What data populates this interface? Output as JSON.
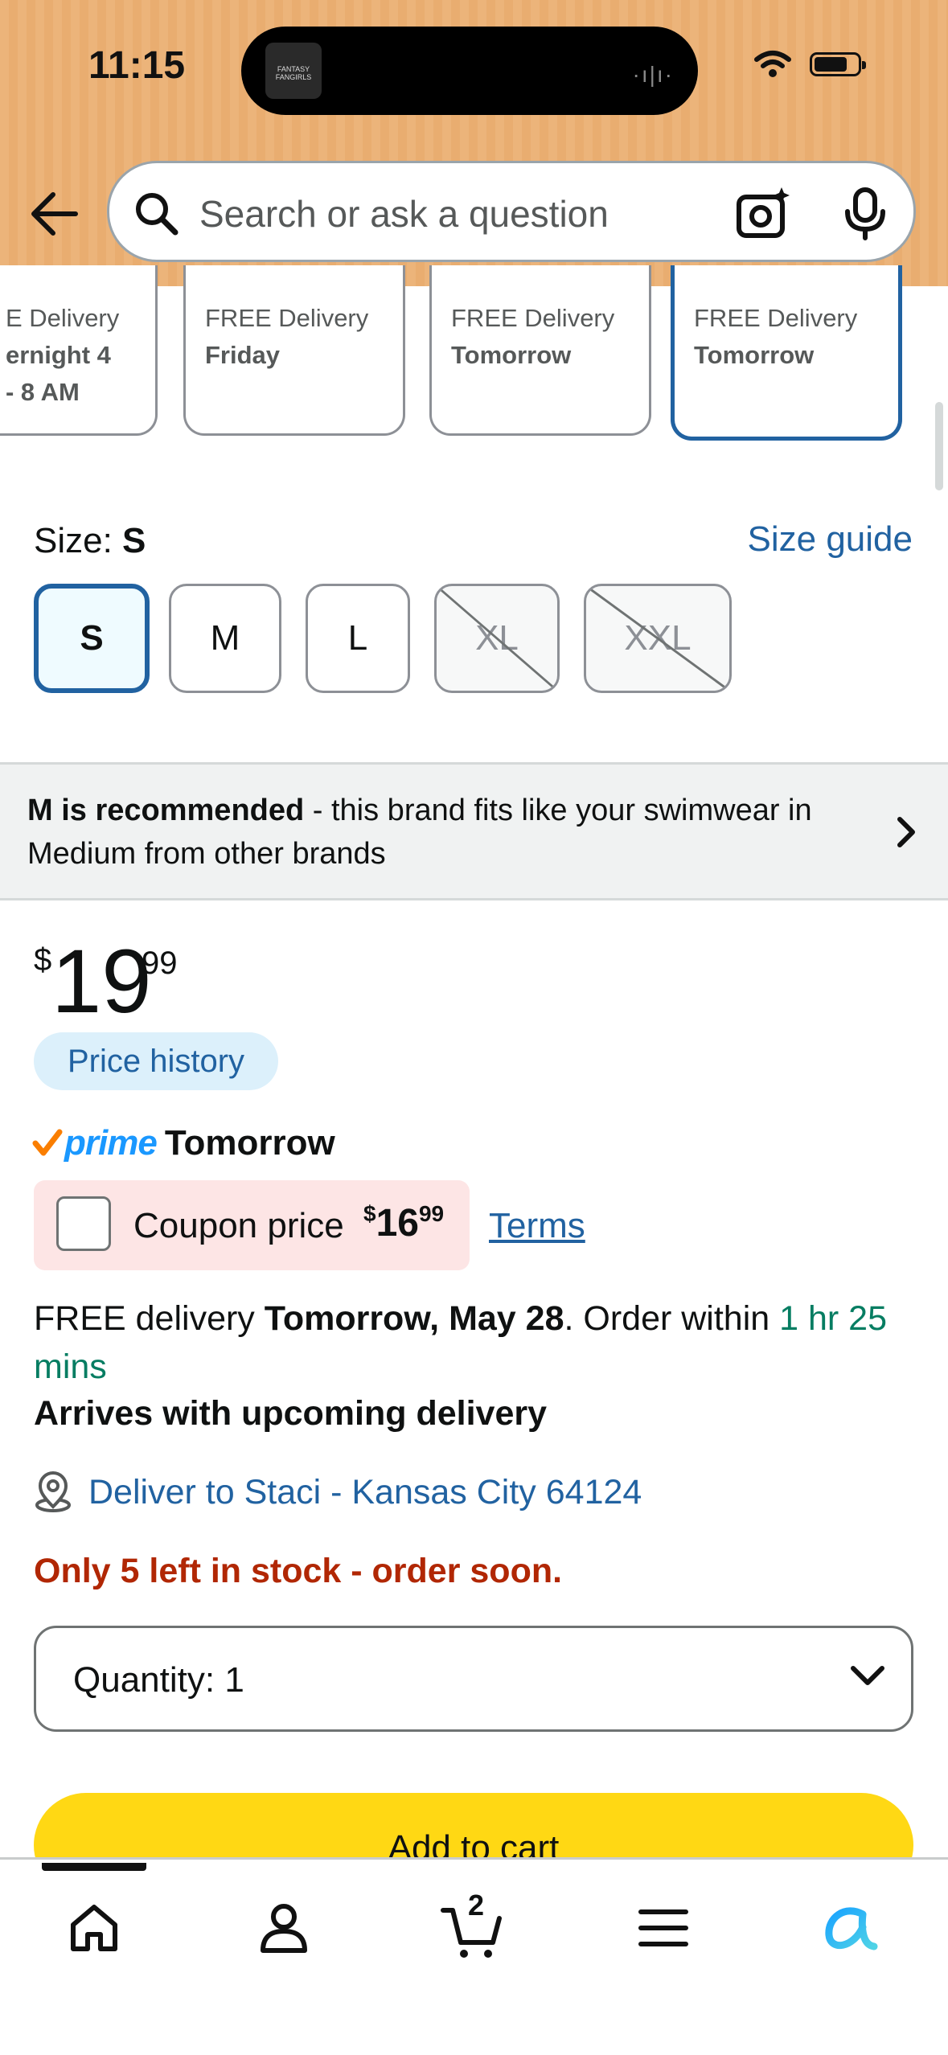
{
  "status_bar": {
    "time": "11:15",
    "island_app_label": "FANTASY FANGIRLS",
    "icons": [
      "wifi-icon",
      "battery-icon"
    ]
  },
  "header": {
    "back_icon": "back-arrow-icon",
    "search_placeholder": "Search or ask a question",
    "camera_icon": "camera-search-icon",
    "mic_icon": "microphone-icon",
    "accent_color": "#ecb47a"
  },
  "delivery_options": [
    {
      "line1": "E Delivery",
      "line2": "ernight 4",
      "line3": "- 8 AM",
      "selected": false
    },
    {
      "line1": "FREE Delivery",
      "line2": "Friday",
      "line3": "",
      "selected": false
    },
    {
      "line1": "FREE Delivery",
      "line2": "Tomorrow",
      "line3": "",
      "selected": false
    },
    {
      "line1": "FREE Delivery",
      "line2": "Tomorrow",
      "line3": "",
      "selected": true
    }
  ],
  "size": {
    "label": "Size: ",
    "selected": "S",
    "guide_link": "Size guide",
    "options": [
      {
        "label": "S",
        "state": "selected"
      },
      {
        "label": "M",
        "state": "available"
      },
      {
        "label": "L",
        "state": "available"
      },
      {
        "label": "XL",
        "state": "unavailable"
      },
      {
        "label": "XXL",
        "state": "unavailable"
      }
    ]
  },
  "recommendation": {
    "bold": "M is recommended",
    "text": " - this brand fits like your swimwear in Medium from other brands"
  },
  "price": {
    "symbol": "$",
    "whole": "19",
    "fraction": "99",
    "history_label": "Price history"
  },
  "prime": {
    "brand": "prime",
    "day": "Tomorrow"
  },
  "coupon": {
    "label": "Coupon price",
    "symbol": "$",
    "whole": "16",
    "fraction": "99",
    "terms_link": "Terms",
    "checked": false
  },
  "delivery": {
    "prefix": "FREE delivery ",
    "date": "Tomorrow, May 28",
    "middle": ". Order within ",
    "countdown": "1 hr 25 mins",
    "arrives": "Arrives with upcoming delivery"
  },
  "deliver_to": "Deliver to Staci - Kansas City 64124",
  "stock": "Only 5 left in stock - order soon.",
  "quantity": {
    "label": "Quantity: ",
    "value": "1"
  },
  "add_to_cart": "Add to cart",
  "bottom_nav": {
    "items": [
      "home-icon",
      "account-icon",
      "cart-icon",
      "menu-icon",
      "rufus-ai-icon"
    ],
    "cart_count": "2"
  },
  "colors": {
    "link_blue": "#2162a1",
    "stock_red": "#b12704",
    "countdown_green": "#067d62",
    "cart_button_yellow": "#ffd814",
    "coupon_bg": "#fde5e5"
  }
}
